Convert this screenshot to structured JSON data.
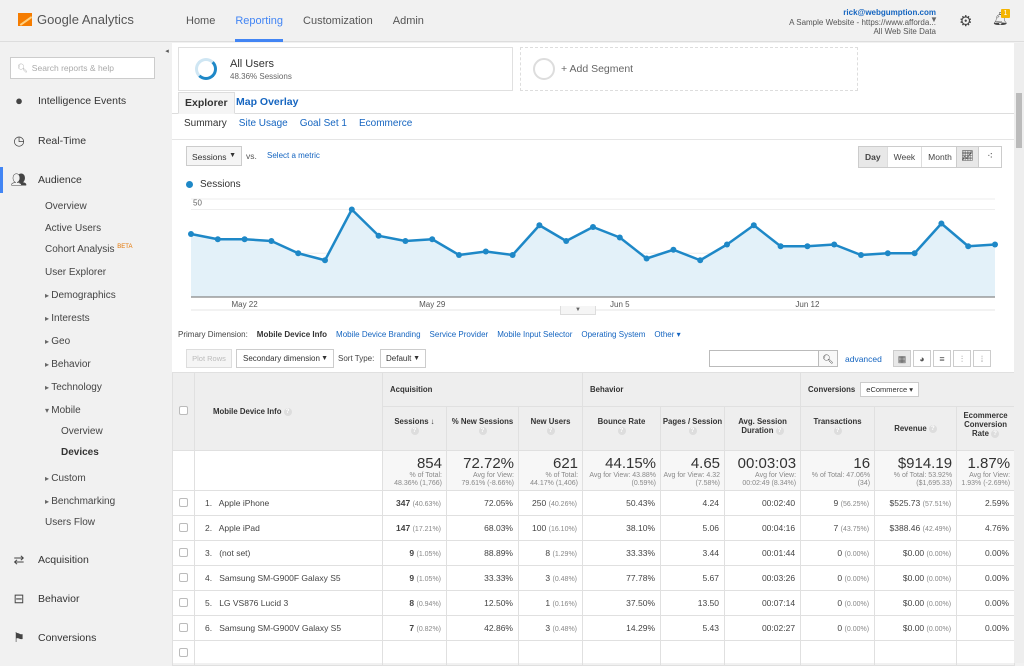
{
  "app": {
    "name": "Google Analytics"
  },
  "nav": [
    "Home",
    "Reporting",
    "Customization",
    "Admin"
  ],
  "nav_active": "Reporting",
  "account": {
    "email": "rick@webgumption.com",
    "site": "A Sample Website - https://www.afforda...",
    "view": "All Web Site Data",
    "notification_count": "1"
  },
  "sidebar": {
    "search_placeholder": "Search reports & help",
    "main": [
      {
        "label": "Intelligence Events",
        "icon": "lightbulb-icon"
      },
      {
        "label": "Real-Time",
        "icon": "clock-icon"
      },
      {
        "label": "Audience",
        "icon": "people-icon"
      },
      {
        "label": "Acquisition",
        "icon": "arrows-icon"
      },
      {
        "label": "Behavior",
        "icon": "layout-icon"
      },
      {
        "label": "Conversions",
        "icon": "flag-icon"
      }
    ],
    "audience_items": [
      "Overview",
      "Active Users",
      "Cohort Analysis",
      "User Explorer",
      "Demographics",
      "Interests",
      "Geo",
      "Behavior",
      "Technology",
      "Mobile",
      "Custom",
      "Benchmarking",
      "Users Flow"
    ],
    "beta": "BETA",
    "mobile_items": [
      "Overview",
      "Devices"
    ]
  },
  "segments": {
    "all_users": "All Users",
    "all_users_sub": "48.36% Sessions",
    "add": "+ Add Segment"
  },
  "tabs": {
    "explorer": "Explorer",
    "map": "Map Overlay"
  },
  "subtabs": [
    "Summary",
    "Site Usage",
    "Goal Set 1",
    "Ecommerce"
  ],
  "chart_controls": {
    "metric": "Sessions",
    "vs": "vs.",
    "select_metric": "Select a metric",
    "granularity": [
      "Day",
      "Week",
      "Month"
    ],
    "active_granularity": "Day"
  },
  "chart_data": {
    "type": "area",
    "legend": [
      "Sessions"
    ],
    "color": "#1e88c7",
    "x_labels": [
      "May 22",
      "May 29",
      "Jun 5",
      "Jun 12"
    ],
    "x_label_index": [
      2,
      9,
      16,
      23
    ],
    "yticks": [
      25,
      50
    ],
    "ylim": [
      0,
      56
    ],
    "series": [
      {
        "name": "Sessions",
        "values": [
          36,
          33,
          33,
          32,
          25,
          21,
          50,
          35,
          32,
          33,
          24,
          26,
          24,
          41,
          32,
          40,
          34,
          22,
          27,
          21,
          30,
          41,
          29,
          29,
          30,
          24,
          25,
          25,
          42,
          29,
          30
        ]
      }
    ]
  },
  "primary_dimension": {
    "label": "Primary Dimension:",
    "current": "Mobile Device Info",
    "options": [
      "Mobile Device Branding",
      "Service Provider",
      "Mobile Input Selector",
      "Operating System"
    ],
    "other": "Other"
  },
  "toolbar": {
    "plot_rows": "Plot Rows",
    "secondary": "Secondary dimension",
    "sort_label": "Sort Type:",
    "sort": "Default",
    "advanced": "advanced"
  },
  "table": {
    "dim_header": "Mobile Device Info",
    "groups": {
      "acq": "Acquisition",
      "beh": "Behavior",
      "conv": "Conversions",
      "conv_sel": "eCommerce"
    },
    "headers": [
      "Sessions",
      "% New Sessions",
      "New Users",
      "Bounce Rate",
      "Pages / Session",
      "Avg. Session Duration",
      "Transactions",
      "Revenue",
      "Ecommerce Conversion Rate"
    ],
    "totals": [
      {
        "v": "854",
        "s": "% of Total: 48.36% (1,766)"
      },
      {
        "v": "72.72%",
        "s": "Avg for View: 79.61% (-8.66%)"
      },
      {
        "v": "621",
        "s": "% of Total: 44.17% (1,406)"
      },
      {
        "v": "44.15%",
        "s": "Avg for View: 43.88% (0.59%)"
      },
      {
        "v": "4.65",
        "s": "Avg for View: 4.32 (7.58%)"
      },
      {
        "v": "00:03:03",
        "s": "Avg for View: 00:02:49 (8.34%)"
      },
      {
        "v": "16",
        "s": "% of Total: 47.06% (34)"
      },
      {
        "v": "$914.19",
        "s": "% of Total: 53.92% ($1,695.33)"
      },
      {
        "v": "1.87%",
        "s": "Avg for View: 1.93% (-2.69%)"
      }
    ],
    "rows": [
      {
        "n": "1.",
        "name": "Apple iPhone",
        "sess": "347",
        "sessp": "(40.63%)",
        "pns": "72.05%",
        "nu": "250",
        "nup": "(40.26%)",
        "br": "50.43%",
        "ps": "4.24",
        "dur": "00:02:40",
        "tr": "9",
        "trp": "(56.25%)",
        "rev": "$525.73",
        "revp": "(57.51%)",
        "cr": "2.59%"
      },
      {
        "n": "2.",
        "name": "Apple iPad",
        "sess": "147",
        "sessp": "(17.21%)",
        "pns": "68.03%",
        "nu": "100",
        "nup": "(16.10%)",
        "br": "38.10%",
        "ps": "5.06",
        "dur": "00:04:16",
        "tr": "7",
        "trp": "(43.75%)",
        "rev": "$388.46",
        "revp": "(42.49%)",
        "cr": "4.76%"
      },
      {
        "n": "3.",
        "name": "(not set)",
        "sess": "9",
        "sessp": "(1.05%)",
        "pns": "88.89%",
        "nu": "8",
        "nup": "(1.29%)",
        "br": "33.33%",
        "ps": "3.44",
        "dur": "00:01:44",
        "tr": "0",
        "trp": "(0.00%)",
        "rev": "$0.00",
        "revp": "(0.00%)",
        "cr": "0.00%"
      },
      {
        "n": "4.",
        "name": "Samsung SM-G900F Galaxy S5",
        "sess": "9",
        "sessp": "(1.05%)",
        "pns": "33.33%",
        "nu": "3",
        "nup": "(0.48%)",
        "br": "77.78%",
        "ps": "5.67",
        "dur": "00:03:26",
        "tr": "0",
        "trp": "(0.00%)",
        "rev": "$0.00",
        "revp": "(0.00%)",
        "cr": "0.00%"
      },
      {
        "n": "5.",
        "name": "LG VS876 Lucid 3",
        "sess": "8",
        "sessp": "(0.94%)",
        "pns": "12.50%",
        "nu": "1",
        "nup": "(0.16%)",
        "br": "37.50%",
        "ps": "13.50",
        "dur": "00:07:14",
        "tr": "0",
        "trp": "(0.00%)",
        "rev": "$0.00",
        "revp": "(0.00%)",
        "cr": "0.00%"
      },
      {
        "n": "6.",
        "name": "Samsung SM-G900V Galaxy S5",
        "sess": "7",
        "sessp": "(0.82%)",
        "pns": "42.86%",
        "nu": "3",
        "nup": "(0.48%)",
        "br": "14.29%",
        "ps": "5.43",
        "dur": "00:02:27",
        "tr": "0",
        "trp": "(0.00%)",
        "rev": "$0.00",
        "revp": "(0.00%)",
        "cr": "0.00%"
      }
    ]
  }
}
